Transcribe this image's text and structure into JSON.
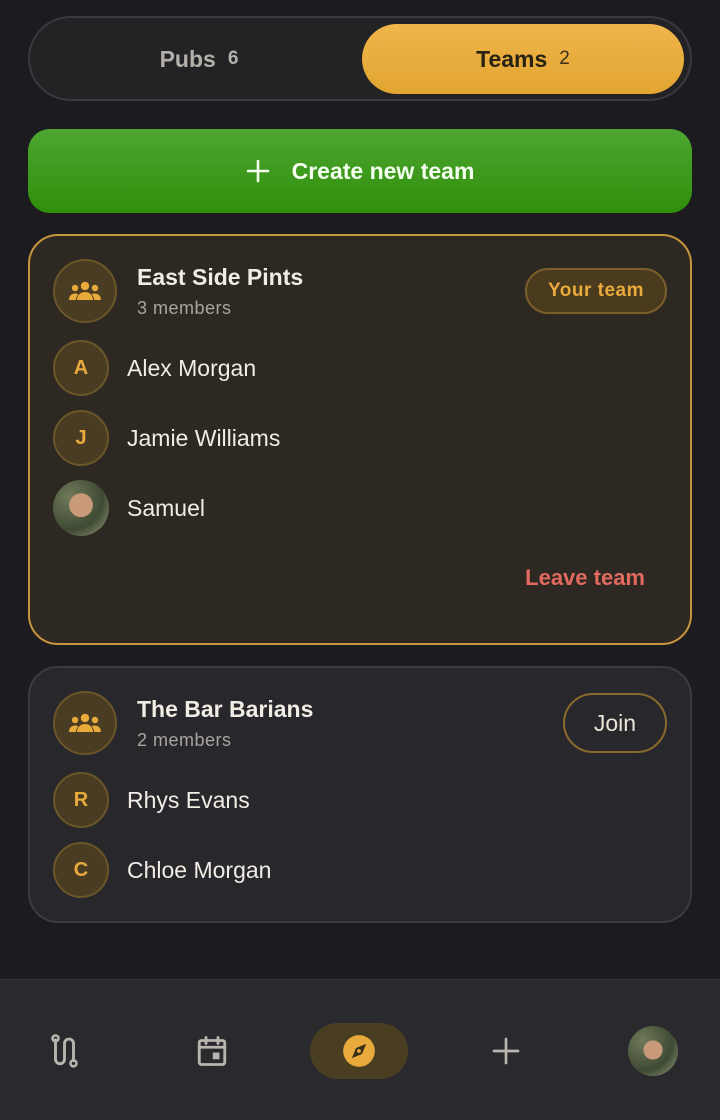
{
  "tabs": {
    "pubs": {
      "label": "Pubs",
      "count": "6"
    },
    "teams": {
      "label": "Teams",
      "count": "2"
    }
  },
  "create_button": {
    "label": "Create new team"
  },
  "teams": [
    {
      "name": "East Side Pints",
      "members_label": "3 members",
      "badge": "Your team",
      "action": "Leave team",
      "members": [
        {
          "initial": "A",
          "name": "Alex Morgan"
        },
        {
          "initial": "J",
          "name": "Jamie Williams"
        },
        {
          "initial": "",
          "name": "Samuel"
        }
      ]
    },
    {
      "name": "The Bar Barians",
      "members_label": "2 members",
      "action": "Join",
      "members": [
        {
          "initial": "R",
          "name": "Rhys Evans"
        },
        {
          "initial": "C",
          "name": "Chloe Morgan"
        }
      ]
    }
  ],
  "nav": {
    "items": [
      "route-icon",
      "calendar-icon",
      "compass-icon",
      "plus-icon",
      "profile-avatar"
    ],
    "active": "compass-icon"
  },
  "colors": {
    "background": "#1c1b1f",
    "accent": "#e9aa3c",
    "create_green": "#3a9a1c",
    "danger": "#e26a5f"
  }
}
